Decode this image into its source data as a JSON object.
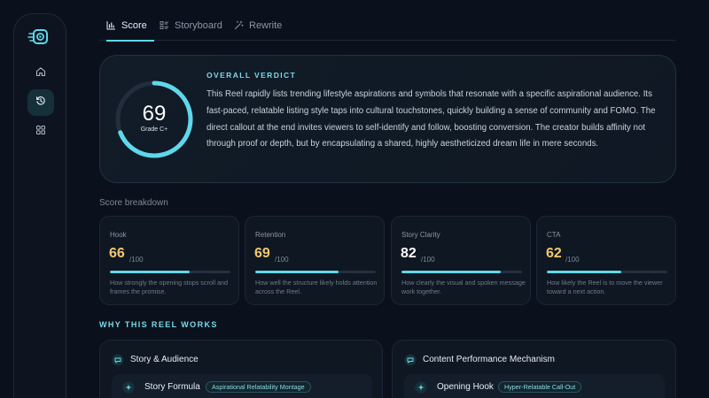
{
  "tabs": [
    {
      "label": "Score",
      "active": true,
      "icon": "bar-chart-icon"
    },
    {
      "label": "Storyboard",
      "active": false,
      "icon": "storyboard-icon"
    },
    {
      "label": "Rewrite",
      "active": false,
      "icon": "magic-wand-icon"
    }
  ],
  "sidebar": {
    "items": [
      {
        "icon": "home-icon",
        "active": false
      },
      {
        "icon": "history-icon",
        "active": true
      },
      {
        "icon": "grid-icon",
        "active": false
      }
    ]
  },
  "verdict": {
    "score": "69",
    "score_fraction": 0.69,
    "grade": "Grade C+",
    "label": "OVERALL VERDICT",
    "text": "This Reel rapidly lists trending lifestyle aspirations and symbols that resonate with a specific aspirational audience. Its fast-paced, relatable listing style taps into cultural touchstones, quickly building a sense of community and FOMO. The direct callout at the end invites viewers to self-identify and follow, boosting conversion. The creator builds affinity not through proof or depth, but by encapsulating a shared, highly aestheticized dream life in mere seconds."
  },
  "breakdown": {
    "title": "Score breakdown",
    "cards": [
      {
        "label": "Hook",
        "value": "66",
        "outof": "/100",
        "fraction": 0.66,
        "status": "warn",
        "desc": "How strongly the opening stops scroll and frames the promise."
      },
      {
        "label": "Retention",
        "value": "69",
        "outof": "/100",
        "fraction": 0.69,
        "status": "warn",
        "desc": "How well the structure likely holds attention across the Reel."
      },
      {
        "label": "Story Clarity",
        "value": "82",
        "outof": "/100",
        "fraction": 0.82,
        "status": "good",
        "desc": "How clearly the visual and spoken message work together."
      },
      {
        "label": "CTA",
        "value": "62",
        "outof": "/100",
        "fraction": 0.62,
        "status": "warn",
        "desc": "How likely the Reel is to move the viewer toward a next action."
      }
    ]
  },
  "why": {
    "title": "WHY THIS REEL WORKS",
    "cards": [
      {
        "title": "Story & Audience",
        "icon": "chat-bubble-icon",
        "item_title": "Story Formula",
        "item_icon": "sparkle-icon",
        "pill": "Aspirational Relatability Montage"
      },
      {
        "title": "Content Performance Mechanism",
        "icon": "chat-bubble-icon",
        "item_title": "Opening Hook",
        "item_icon": "sparkle-icon",
        "pill": "Hyper-Relatable Call-Out"
      }
    ]
  },
  "colors": {
    "accent": "#5ed8ea",
    "warn": "#f1c86a",
    "background": "#0b111c"
  }
}
